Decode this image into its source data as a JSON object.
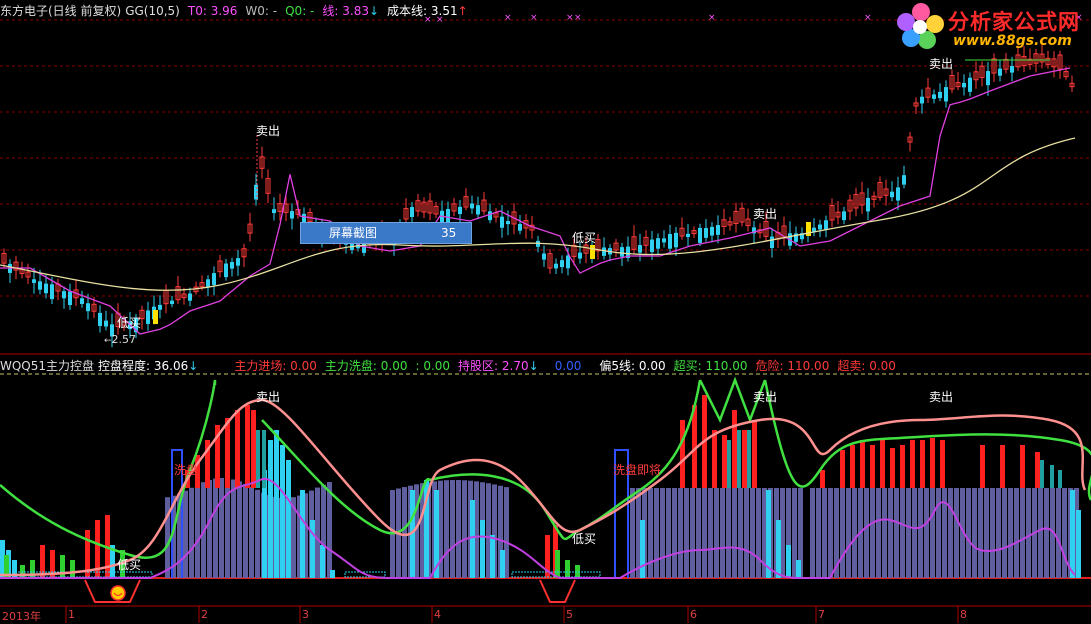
{
  "top_header": {
    "stock": "东方电子(日线 前复权)",
    "indicator": "GG(10,5)",
    "t0": "T0: 3.96",
    "w0": "W0: -",
    "q0": "Q0: -",
    "line": "线: 3.83",
    "line_arrow": "↓",
    "cost_line": "成本线: 3.51",
    "cost_arrow": "↑"
  },
  "sub_header": {
    "indicator": "WQQ51主力控盘",
    "control_degree": "控盘程度: 36.06",
    "control_arrow": "↓",
    "main_enter": "主力进场: 0.00",
    "main_wash": "主力洗盘: 0.00",
    "colon_val": ": 0.00",
    "hold_zone": "持股区: 2.70",
    "hold_arrow": "↓",
    "blue_val": "0.00",
    "dev5": "偏5线: 0.00",
    "overbuy": "超买: 110.00",
    "danger": "危险: 110.00",
    "oversell": "超卖: 0.00"
  },
  "price_labels": {
    "sell1": "卖出",
    "sell2": "卖出",
    "sell3": "卖出",
    "lowbuy1": "低买",
    "lowbuy2": "低买",
    "low_price": "2.57"
  },
  "sub_labels": {
    "sell1": "卖出",
    "sell2": "卖出",
    "sell3": "卖出",
    "wash1": "洗盘",
    "wash2": "洗盘即将",
    "lowbuy1": "低买",
    "lowbuy2": "低买"
  },
  "tooltip": {
    "label": "屏幕截图",
    "value": "35"
  },
  "logo": {
    "title": "分析家公式网",
    "url": "www.88gs.com"
  },
  "xaxis": [
    "2013年",
    "1",
    "2",
    "3",
    "4",
    "5",
    "6",
    "7",
    "8"
  ],
  "colors": {
    "up": "#ff3b3b",
    "down": "#2fd0f0",
    "ma1": "#e040e0",
    "ma2": "#e8e0a0",
    "grid": "#8b0000"
  }
}
